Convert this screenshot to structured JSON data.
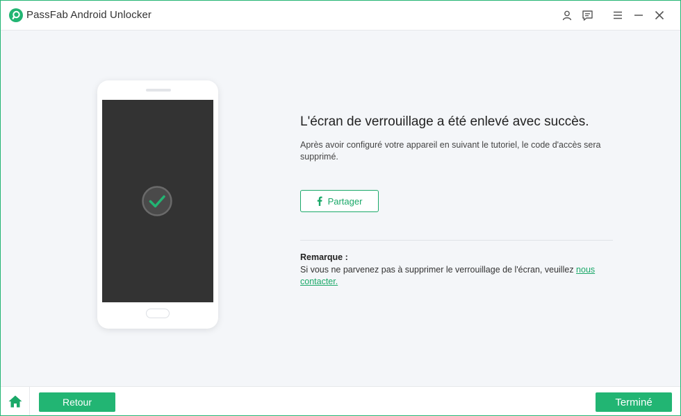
{
  "window": {
    "title": "PassFab Android Unlocker",
    "accent_color": "#22b573",
    "icons": [
      "passfab-logo-icon",
      "user-icon",
      "feedback-icon",
      "menu-icon",
      "minimize-icon",
      "close-icon"
    ]
  },
  "main": {
    "headline": "L'écran de verrouillage a été enlevé avec succès.",
    "description": "Après avoir configuré votre appareil en suivant le tutoriel, le code d'accès sera supprimé.",
    "share_label": "Partager",
    "share_icon": "facebook-icon",
    "phone_status_icon": "check-circle-icon",
    "note_title": "Remarque :",
    "note_text": "Si vous ne parvenez pas à supprimer le verrouillage de l'écran, veuillez ",
    "note_link": "nous contacter."
  },
  "footer": {
    "home_icon": "home-icon",
    "back_label": "Retour",
    "done_label": "Terminé"
  }
}
